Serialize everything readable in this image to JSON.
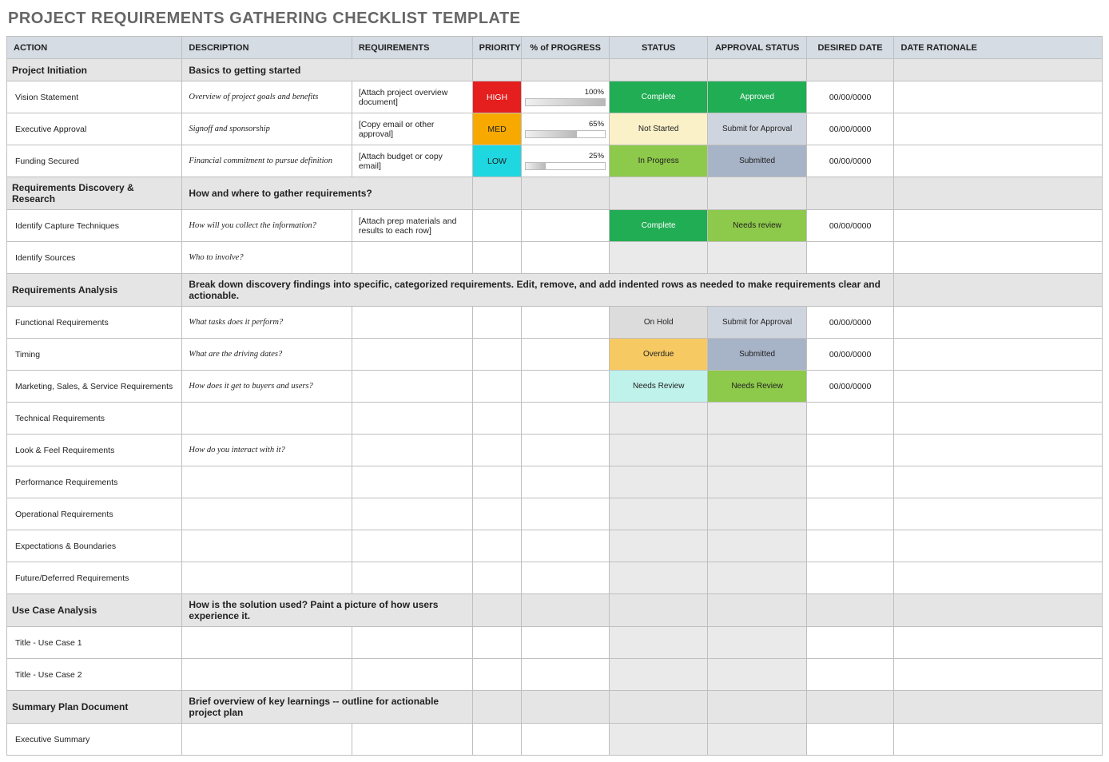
{
  "title": "PROJECT REQUIREMENTS GATHERING CHECKLIST TEMPLATE",
  "columns": [
    "ACTION",
    "DESCRIPTION",
    "REQUIREMENTS",
    "PRIORITY",
    "% of PROGRESS",
    "STATUS",
    "APPROVAL STATUS",
    "DESIRED DATE",
    "DATE RATIONALE"
  ],
  "rows": [
    {
      "type": "section",
      "action": "Project Initiation",
      "desc": "Basics to getting started"
    },
    {
      "type": "data",
      "action": "Vision Statement",
      "desc": "Overview of project goals and benefits",
      "req": "[Attach project overview document]",
      "priority": "HIGH",
      "progress": 100,
      "status": "Complete",
      "approval": "Approved",
      "date": "00/00/0000"
    },
    {
      "type": "data",
      "action": "Executive Approval",
      "desc": "Signoff and sponsorship",
      "req": "[Copy email or other approval]",
      "priority": "MED",
      "progress": 65,
      "status": "Not Started",
      "approval": "Submit for Approval",
      "date": "00/00/0000"
    },
    {
      "type": "data",
      "action": "Funding Secured",
      "desc": "Financial commitment to pursue definition",
      "req": "[Attach budget or copy email]",
      "priority": "LOW",
      "progress": 25,
      "status": "In Progress",
      "approval": "Submitted",
      "date": "00/00/0000"
    },
    {
      "type": "section",
      "action": "Requirements Discovery & Research",
      "desc": "How and where to gather requirements?"
    },
    {
      "type": "data",
      "action": "Identify Capture Techniques",
      "desc": "How will you collect the information?",
      "req": "[Attach prep materials and results to each row]",
      "status": "Complete",
      "approval": "Needs review",
      "date": "00/00/0000"
    },
    {
      "type": "data",
      "action": "Identify Sources",
      "desc": "Who to involve?",
      "greyStatus": true,
      "greyApproval": true
    },
    {
      "type": "section",
      "action": "Requirements Analysis",
      "desc": "Break down discovery findings into specific, categorized requirements. Edit, remove, and add indented rows as needed to make requirements clear and actionable.",
      "span": true
    },
    {
      "type": "data",
      "action": "Functional Requirements",
      "desc": "What tasks does it perform?",
      "status": "On Hold",
      "approval": "Submit for Approval",
      "date": "00/00/0000"
    },
    {
      "type": "data",
      "action": "Timing",
      "desc": "What are the driving dates?",
      "status": "Overdue",
      "approval": "Submitted",
      "date": "00/00/0000"
    },
    {
      "type": "data",
      "action": "Marketing, Sales, & Service Requirements",
      "desc": "How does it get to buyers and users?",
      "status": "Needs Review",
      "approval": "Needs Review",
      "date": "00/00/0000"
    },
    {
      "type": "data",
      "action": "Technical Requirements",
      "greyStatus": true,
      "greyApproval": true
    },
    {
      "type": "data",
      "action": "Look & Feel Requirements",
      "desc": "How do you interact with it?",
      "greyStatus": true,
      "greyApproval": true
    },
    {
      "type": "data",
      "action": "Performance Requirements",
      "greyStatus": true,
      "greyApproval": true
    },
    {
      "type": "data",
      "action": "Operational Requirements",
      "greyStatus": true,
      "greyApproval": true
    },
    {
      "type": "data",
      "action": "Expectations & Boundaries",
      "greyStatus": true,
      "greyApproval": true
    },
    {
      "type": "data",
      "action": "Future/Deferred Requirements",
      "greyStatus": true,
      "greyApproval": true
    },
    {
      "type": "section",
      "action": "Use Case Analysis",
      "desc": "How is the solution used? Paint a picture of how users experience it."
    },
    {
      "type": "data",
      "action": "Title - Use Case 1",
      "greyStatus": true,
      "greyApproval": true
    },
    {
      "type": "data",
      "action": "Title - Use Case 2",
      "greyStatus": true,
      "greyApproval": true
    },
    {
      "type": "section",
      "action": "Summary Plan Document",
      "desc": "Brief overview of key learnings -- outline for actionable project plan"
    },
    {
      "type": "data",
      "action": "Executive Summary",
      "greyStatus": true,
      "greyApproval": true
    }
  ],
  "statusClasses": {
    "Complete": "s-complete",
    "Not Started": "s-notstarted",
    "In Progress": "s-inprogress",
    "On Hold": "s-onhold",
    "Overdue": "s-overdue",
    "Needs Review": "s-needsreview"
  },
  "approvalClasses": {
    "Approved": "a-approved",
    "Submit for Approval": "a-submitforapproval",
    "Submitted": "a-submitted",
    "Needs review": "a-needsreview",
    "Needs Review": "a-needsreview"
  }
}
